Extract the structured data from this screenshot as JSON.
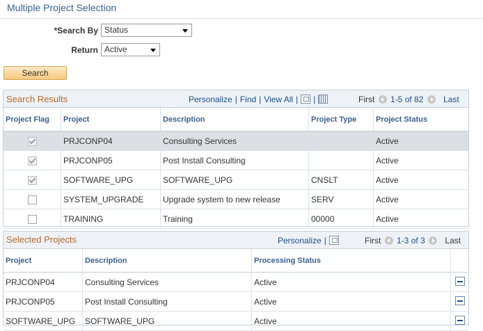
{
  "page": {
    "title": "Multiple Project Selection"
  },
  "filters": {
    "search_by_label": "*Search By",
    "search_by_value": "Status",
    "return_label": "Return",
    "return_value": "Active",
    "search_button": "Search"
  },
  "search_results": {
    "title": "Search Results",
    "personalize": "Personalize",
    "find": "Find",
    "view_all": "View All",
    "first": "First",
    "range": "1-5 of 82",
    "last": "Last",
    "columns": [
      "Project Flag",
      "Project",
      "Description",
      "Project Type",
      "Project Status"
    ],
    "rows": [
      {
        "flag": true,
        "project": "PRJCONP04",
        "description": "Consulting Services",
        "type": "",
        "status": "Active"
      },
      {
        "flag": true,
        "project": "PRJCONP05",
        "description": "Post Install Consulting",
        "type": "",
        "status": "Active"
      },
      {
        "flag": true,
        "project": "SOFTWARE_UPG",
        "description": "SOFTWARE_UPG",
        "type": "CNSLT",
        "status": "Active"
      },
      {
        "flag": false,
        "project": "SYSTEM_UPGRADE",
        "description": "Upgrade system to new release",
        "type": "SERV",
        "status": "Active"
      },
      {
        "flag": false,
        "project": "TRAINING",
        "description": "Training",
        "type": "00000",
        "status": "Active"
      }
    ]
  },
  "selected_projects": {
    "title": "Selected Projects",
    "personalize": "Personalize",
    "first": "First",
    "range": "1-3 of 3",
    "last": "Last",
    "columns": [
      "Project",
      "Description",
      "Processing Status"
    ],
    "rows": [
      {
        "project": "PRJCONP04",
        "description": "Consulting Services",
        "status": "Active"
      },
      {
        "project": "PRJCONP05",
        "description": "Post Install Consulting",
        "status": "Active"
      },
      {
        "project": "SOFTWARE_UPG",
        "description": "SOFTWARE_UPG",
        "status": "Active"
      }
    ]
  },
  "icons": {
    "zoom": "zoom-icon",
    "download": "spreadsheet-icon",
    "prev": "prev-arrow-icon",
    "next": "next-arrow-icon",
    "remove": "delete-row-icon"
  },
  "colors": {
    "accent": "#3a5f8f",
    "section_title": "#b7692b",
    "link": "#1a4d8a",
    "button": "#f8c97d"
  }
}
